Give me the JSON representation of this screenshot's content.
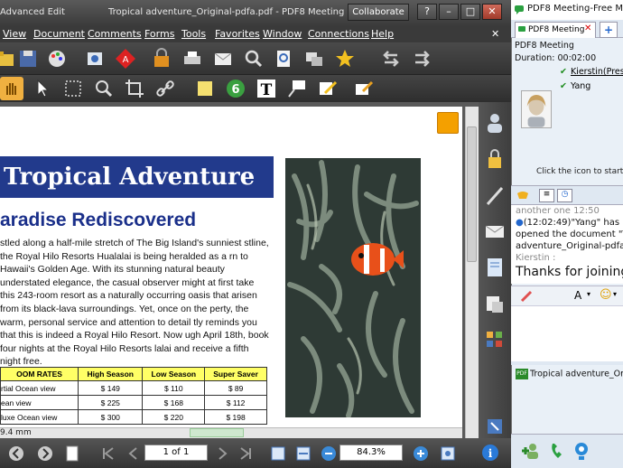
{
  "window": {
    "app_label": "Advanced Edit",
    "doc_title": "Tropical adventure_Original-pdfa.pdf - PDF8 Meeting",
    "collaborate_label": "Collaborate",
    "btn_help": "?",
    "btn_min": "–",
    "btn_max": "□",
    "btn_close": "✕"
  },
  "menu": [
    "View",
    "Document",
    "Comments",
    "Forms",
    "Tools",
    "Favorites",
    "Window",
    "Connections",
    "Help"
  ],
  "document": {
    "title": "Tropical Adventure",
    "subtitle": "aradise Rediscovered",
    "body": "stled along a half-mile stretch of The Big Island's sunniest stline, the Royal Hilo Resorts Hualalai is being heralded as a rn to Hawaii's Golden Age. With its stunning natural beauty understated elegance, the casual observer might at first take this 243-room resort as a naturally occurring oasis that arisen from its black-lava surroundings. Yet, once on the perty, the warm, personal service and attention to detail tly reminds you that this is indeed a Royal Hilo Resort. Now ugh April 18th, book four nights at the Royal Hilo Resorts lalai and receive a fifth night free.",
    "table": {
      "headers": [
        "OOM RATES",
        "High Season",
        "Low Season",
        "Super Saver"
      ],
      "rows": [
        [
          "rtial Ocean view",
          "$ 149",
          "$ 110",
          "$ 89"
        ],
        [
          "ean view",
          "$ 225",
          "$ 168",
          "$ 112"
        ],
        [
          "luxe Ocean view",
          "$ 300",
          "$ 220",
          "$ 198"
        ]
      ]
    },
    "page_size_label": "9.4 mm"
  },
  "status": {
    "page_indicator": "1 of 1",
    "zoom": "84.3%"
  },
  "meeting": {
    "panel_title": "PDF8 Meeting-Free Meeti",
    "tab_label": "PDF8 Meeting",
    "tab_close": "✕",
    "tab_add": "+",
    "info_name": "PDF8 Meeting",
    "duration": "Duration: 00:02:00",
    "users": [
      "Kierstin(Pres",
      "Yang"
    ],
    "hint": "Click the icon to start a",
    "chat": {
      "line0": "another one    12:50",
      "line1": "(12:02:49)\"Yang\" has",
      "line2": "opened the document \"T",
      "line3": "adventure_Original-pdfa",
      "sender": "Kierstin :",
      "message": "Thanks for joining"
    },
    "compose_font": "A",
    "file_name": "Tropical adventure_Origin"
  }
}
